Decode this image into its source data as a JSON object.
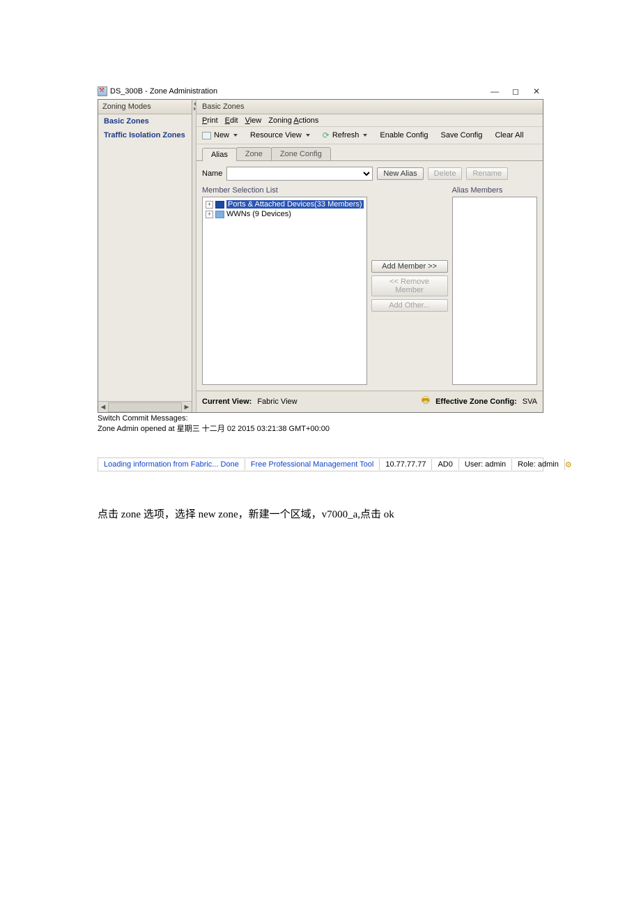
{
  "window": {
    "title": "DS_300B - Zone Administration",
    "min": "—",
    "max": "◻",
    "close": "✕"
  },
  "sidebar": {
    "header": "Zoning Modes",
    "items": [
      "Basic Zones",
      "Traffic Isolation Zones"
    ]
  },
  "main": {
    "header": "Basic Zones",
    "menu": {
      "print": "Print",
      "edit": "Edit",
      "view": "View",
      "zactions": "Zoning Actions"
    },
    "toolbar": {
      "new": "New",
      "resview": "Resource View",
      "refresh": "Refresh",
      "enable": "Enable Config",
      "save": "Save Config",
      "clear": "Clear All"
    },
    "tabs": [
      "Alias",
      "Zone",
      "Zone Config"
    ],
    "name_label": "Name",
    "btn_newalias": "New Alias",
    "btn_delete": "Delete",
    "btn_rename": "Rename",
    "left_label": "Member Selection List",
    "right_label": "Alias Members",
    "tree": {
      "n1": "Ports & Attached Devices(33 Members)",
      "n2": "WWNs (9 Devices)"
    },
    "mid": {
      "add": "Add Member >>",
      "remove": "<< Remove Member",
      "other": "Add Other..."
    },
    "footer": {
      "curview_l": "Current View:",
      "curview_v": "Fabric View",
      "eff_l": "Effective Zone Config:",
      "eff_v": "SVA"
    }
  },
  "commit": {
    "l1": "Switch Commit Messages:",
    "l2": "Zone Admin opened at 星期三 十二月 02 2015 03:21:38 GMT+00:00"
  },
  "status": {
    "loading": "Loading information from Fabric... Done",
    "link": "Free Professional Management Tool",
    "ip": "10.77.77.77",
    "ad": "AD0",
    "user": "User: admin",
    "role": "Role: admin"
  },
  "instruction": "点击 zone 选项，选择 new zone，新建一个区域，v7000_a,点击 ok"
}
